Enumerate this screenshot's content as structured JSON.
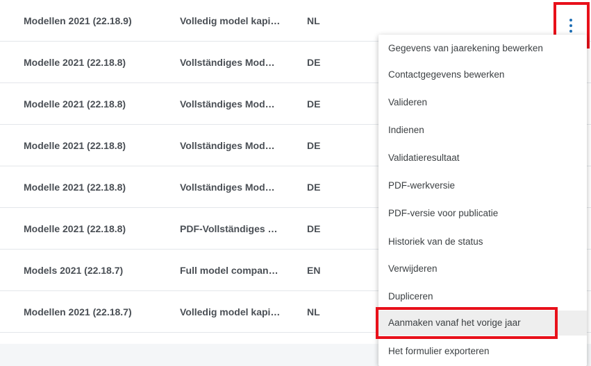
{
  "table": {
    "rows": [
      {
        "model": "Modellen 2021 (22.18.9)",
        "description": "Volledig model kapi…",
        "language": "NL"
      },
      {
        "model": "Modelle 2021 (22.18.8)",
        "description": "Vollständiges Mod…",
        "language": "DE"
      },
      {
        "model": "Modelle 2021 (22.18.8)",
        "description": "Vollständiges Mod…",
        "language": "DE"
      },
      {
        "model": "Modelle 2021 (22.18.8)",
        "description": "Vollständiges Mod…",
        "language": "DE"
      },
      {
        "model": "Modelle 2021 (22.18.8)",
        "description": "Vollständiges Mod…",
        "language": "DE"
      },
      {
        "model": "Modelle 2021 (22.18.8)",
        "description": "PDF-Vollständiges …",
        "language": "DE"
      },
      {
        "model": "Models 2021 (22.18.7)",
        "description": "Full model compan…",
        "language": "EN"
      },
      {
        "model": "Modellen 2021 (22.18.7)",
        "description": "Volledig model kapi…",
        "language": "NL"
      }
    ]
  },
  "row_actions": {
    "icon": "kebab-menu-icon",
    "color": "#1f6fb5"
  },
  "context_menu": {
    "items": [
      {
        "label": "Gegevens van jaarekening bewerken"
      },
      {
        "label": "Contactgegevens bewerken"
      },
      {
        "label": "Valideren"
      },
      {
        "label": "Indienen"
      },
      {
        "label": "Validatieresultaat"
      },
      {
        "label": "PDF-werkversie"
      },
      {
        "label": "PDF-versie voor publicatie"
      },
      {
        "label": "Historiek van de status"
      },
      {
        "label": "Verwijderen"
      },
      {
        "label": "Dupliceren"
      },
      {
        "label": "Aanmaken vanaf het vorige jaar"
      },
      {
        "label": "Het formulier exporteren"
      }
    ],
    "hovered_item": "Aanmaken vanaf het vorige jaar"
  },
  "annotations": {
    "highlight_color": "#e8101a"
  }
}
